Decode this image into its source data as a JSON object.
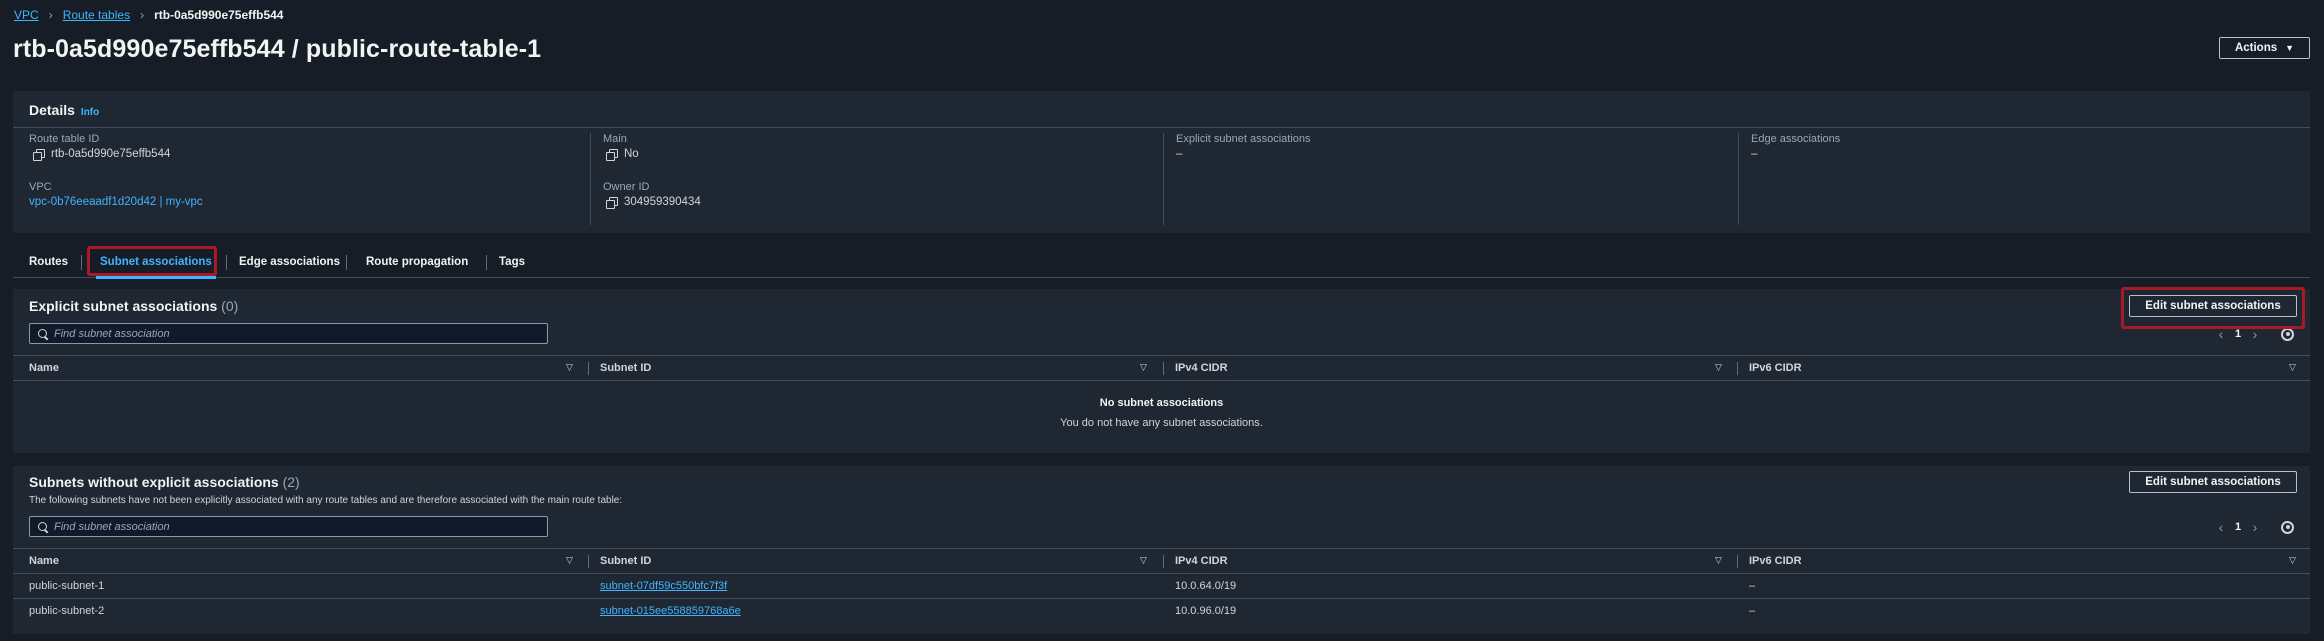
{
  "breadcrumb": {
    "root": "VPC",
    "section": "Route tables",
    "current": "rtb-0a5d990e75effb544"
  },
  "page_title": "rtb-0a5d990e75effb544 / public-route-table-1",
  "actions_label": "Actions",
  "details": {
    "header": "Details",
    "info": "Info",
    "route_table_id_label": "Route table ID",
    "route_table_id": "rtb-0a5d990e75effb544",
    "vpc_label": "VPC",
    "vpc": "vpc-0b76eeaadf1d20d42 | my-vpc",
    "main_label": "Main",
    "main": "No",
    "owner_id_label": "Owner ID",
    "owner_id": "304959390434",
    "explicit_label": "Explicit subnet associations",
    "explicit_value": "–",
    "edge_label": "Edge associations",
    "edge_value": "–"
  },
  "tabs": [
    "Routes",
    "Subnet associations",
    "Edge associations",
    "Route propagation",
    "Tags"
  ],
  "explicit": {
    "title": "Explicit subnet associations",
    "count": "(0)",
    "edit_label": "Edit subnet associations",
    "search_placeholder": "Find subnet association",
    "page": "1",
    "columns": [
      "Name",
      "Subnet ID",
      "IPv4 CIDR",
      "IPv6 CIDR"
    ],
    "empty_title": "No subnet associations",
    "empty_sub": "You do not have any subnet associations."
  },
  "without": {
    "title": "Subnets without explicit associations",
    "count": "(2)",
    "description": "The following subnets have not been explicitly associated with any route tables and are therefore associated with the main route table:",
    "edit_label": "Edit subnet associations",
    "search_placeholder": "Find subnet association",
    "page": "1",
    "columns": [
      "Name",
      "Subnet ID",
      "IPv4 CIDR",
      "IPv6 CIDR"
    ],
    "rows": [
      {
        "name": "public-subnet-1",
        "subnet_id": "subnet-07df59c550bfc7f3f",
        "ipv4": "10.0.64.0/19",
        "ipv6": "–"
      },
      {
        "name": "public-subnet-2",
        "subnet_id": "subnet-015ee558859768a6e",
        "ipv4": "10.0.96.0/19",
        "ipv6": "–"
      }
    ]
  },
  "colors": {
    "background": "#161d26",
    "panel": "#1e2732",
    "link": "#42b4ff",
    "highlight": "#a81a2a"
  },
  "icons": [
    "chevron-right-icon",
    "copy-icon",
    "search-icon",
    "sort-icon",
    "settings-gear-icon",
    "caret-down-icon"
  ]
}
